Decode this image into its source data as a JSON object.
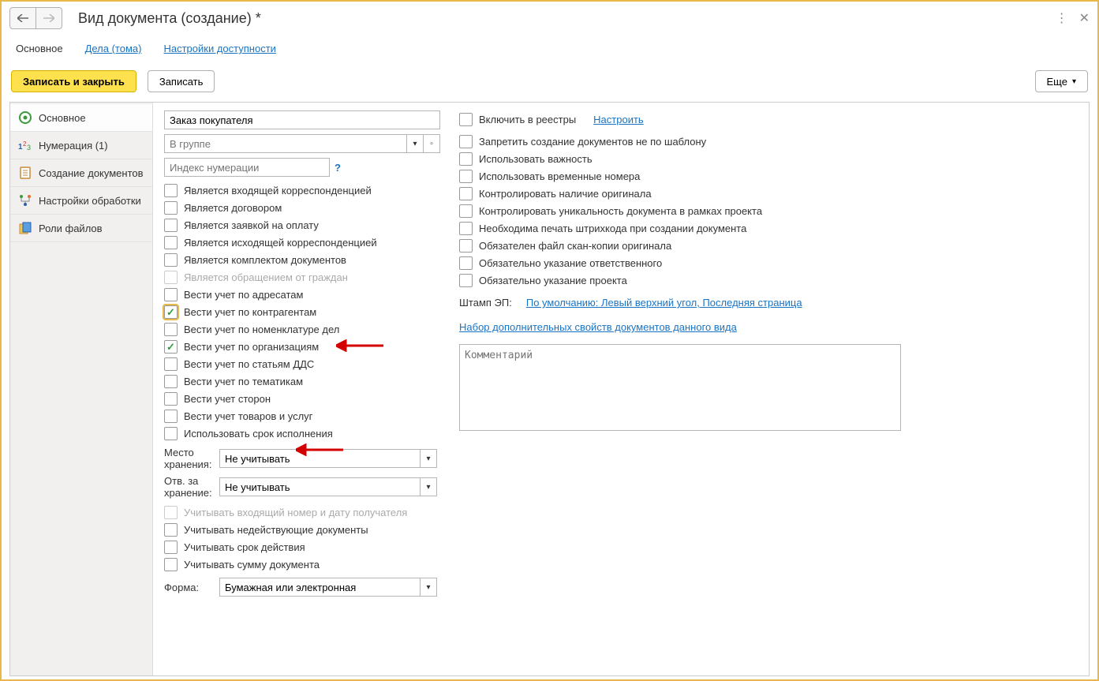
{
  "window": {
    "title": "Вид документа (создание) *"
  },
  "tabs": {
    "main": "Основное",
    "files": "Дела (тома)",
    "access": "Настройки доступности"
  },
  "buttons": {
    "save_close": "Записать и закрыть",
    "save": "Записать",
    "more": "Еще"
  },
  "sidebar": [
    {
      "label": "Основное",
      "icon": "gear"
    },
    {
      "label": "Нумерация (1)",
      "icon": "numbers"
    },
    {
      "label": "Создание документов",
      "icon": "doc"
    },
    {
      "label": "Настройки обработки",
      "icon": "flow"
    },
    {
      "label": "Роли файлов",
      "icon": "files"
    }
  ],
  "fields": {
    "name": {
      "value": "Заказ покупателя"
    },
    "group": {
      "placeholder": "В группе"
    },
    "index": {
      "placeholder": "Индекс нумерации"
    }
  },
  "checks_left": [
    {
      "label": "Является входящей корреспонденцией",
      "checked": false,
      "disabled": false
    },
    {
      "label": "Является договором",
      "checked": false,
      "disabled": false
    },
    {
      "label": "Является заявкой на оплату",
      "checked": false,
      "disabled": false
    },
    {
      "label": "Является исходящей корреспонденцией",
      "checked": false,
      "disabled": false
    },
    {
      "label": "Является комплектом документов",
      "checked": false,
      "disabled": false
    },
    {
      "label": "Является обращением от граждан",
      "checked": false,
      "disabled": true
    },
    {
      "label": "Вести учет по адресатам",
      "checked": false,
      "disabled": false
    },
    {
      "label": "Вести учет по контрагентам",
      "checked": true,
      "disabled": false,
      "highlight": true
    },
    {
      "label": "Вести учет по номенклатуре дел",
      "checked": false,
      "disabled": false
    },
    {
      "label": "Вести учет по организациям",
      "checked": true,
      "disabled": false
    },
    {
      "label": "Вести учет по статьям ДДС",
      "checked": false,
      "disabled": false
    },
    {
      "label": "Вести учет по тематикам",
      "checked": false,
      "disabled": false
    },
    {
      "label": "Вести учет сторон",
      "checked": false,
      "disabled": false
    },
    {
      "label": "Вести учет товаров и услуг",
      "checked": false,
      "disabled": false
    },
    {
      "label": "Использовать срок исполнения",
      "checked": false,
      "disabled": false
    }
  ],
  "storage": {
    "place_label": "Место хранения:",
    "place_value": "Не учитывать",
    "resp_label": "Отв. за хранение:",
    "resp_value": "Не учитывать"
  },
  "checks_left2": [
    {
      "label": "Учитывать входящий номер и дату получателя",
      "checked": false,
      "disabled": true
    },
    {
      "label": "Учитывать недействующие документы",
      "checked": false,
      "disabled": false
    },
    {
      "label": "Учитывать срок действия",
      "checked": false,
      "disabled": false
    },
    {
      "label": "Учитывать сумму документа",
      "checked": false,
      "disabled": false
    }
  ],
  "form": {
    "label": "Форма:",
    "value": "Бумажная или электронная"
  },
  "right": {
    "registry_label": "Включить в реестры",
    "registry_link": "Настроить",
    "checks": [
      {
        "label": "Запретить создание документов не по шаблону",
        "checked": false
      },
      {
        "label": "Использовать важность",
        "checked": false
      },
      {
        "label": "Использовать временные номера",
        "checked": false
      },
      {
        "label": "Контролировать наличие оригинала",
        "checked": false
      },
      {
        "label": "Контролировать уникальность документа в рамках проекта",
        "checked": false
      },
      {
        "label": "Необходима печать штрихкода при создании документа",
        "checked": false
      },
      {
        "label": "Обязателен файл скан-копии оригинала",
        "checked": false
      },
      {
        "label": "Обязательно указание ответственного",
        "checked": false
      },
      {
        "label": "Обязательно указание проекта",
        "checked": false
      }
    ],
    "stamp_label": "Штамп ЭП:",
    "stamp_link": "По умолчанию: Левый верхний угол, Последняя страница",
    "addprops_link": "Набор дополнительных свойств документов данного вида",
    "comment_placeholder": "Комментарий"
  }
}
